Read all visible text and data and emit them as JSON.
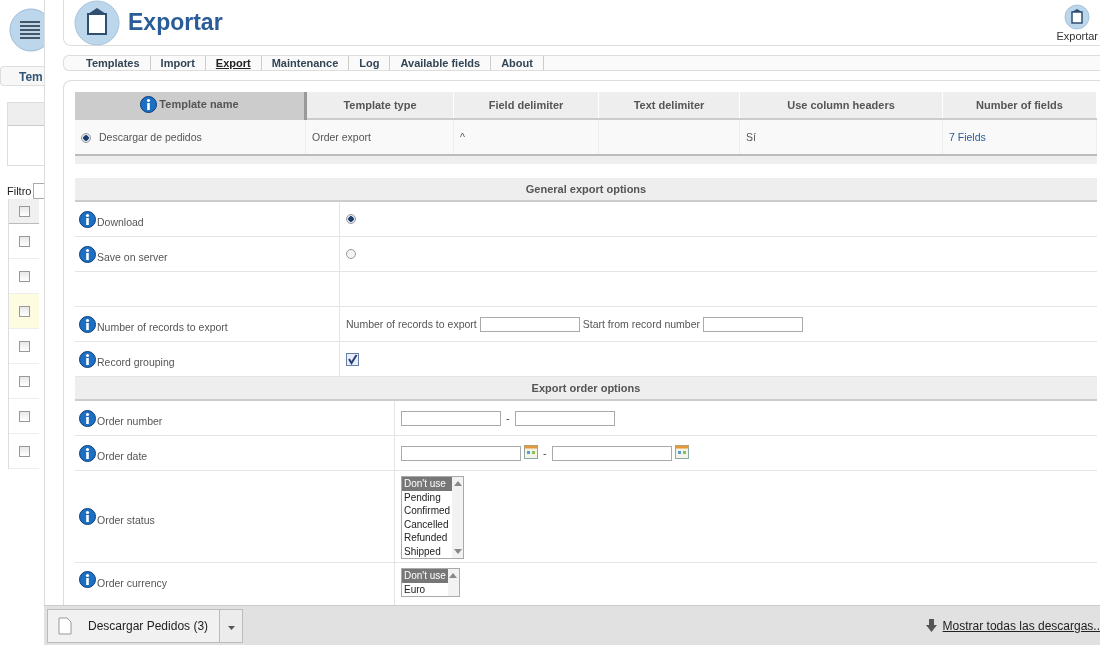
{
  "sidebar": {
    "tab_label": "Tem",
    "filter_label": "Filtro",
    "header_checked": false,
    "rows": [
      {
        "checked": false,
        "highlighted": false
      },
      {
        "checked": false,
        "highlighted": false
      },
      {
        "checked": false,
        "highlighted": true
      },
      {
        "checked": false,
        "highlighted": false
      },
      {
        "checked": false,
        "highlighted": false
      },
      {
        "checked": false,
        "highlighted": false
      },
      {
        "checked": false,
        "highlighted": false
      }
    ]
  },
  "header": {
    "title": "Exportar",
    "toolbar_button": "Exportar"
  },
  "tabs": [
    {
      "label": "Templates",
      "selected": false
    },
    {
      "label": "Import",
      "selected": false
    },
    {
      "label": "Export",
      "selected": true
    },
    {
      "label": "Maintenance",
      "selected": false
    },
    {
      "label": "Log",
      "selected": false
    },
    {
      "label": "Available fields",
      "selected": false
    },
    {
      "label": "About",
      "selected": false
    }
  ],
  "templates": {
    "columns": [
      {
        "label": "Template name",
        "sorted": true
      },
      {
        "label": "Template type",
        "sorted": false
      },
      {
        "label": "Field delimiter",
        "sorted": false
      },
      {
        "label": "Text delimiter",
        "sorted": false
      },
      {
        "label": "Use column headers",
        "sorted": false
      },
      {
        "label": "Number of fields",
        "sorted": false
      }
    ],
    "rows": [
      {
        "selected": true,
        "name": "Descargar de pedidos",
        "type": "Order export",
        "field_delimiter": "^",
        "use_column_headers": "Sí",
        "number_of_fields": "7 Fields"
      }
    ]
  },
  "sections": [
    {
      "title": "General export options",
      "rows": [
        {
          "kind": "radio",
          "label": "Download",
          "selected": true
        },
        {
          "kind": "radio",
          "label": "Save on server",
          "selected": false
        },
        {
          "kind": "blank"
        },
        {
          "kind": "record-range",
          "label": "Number of records to export",
          "fields": [
            {
              "label": "Number of records to export"
            },
            {
              "label": "Start from record number"
            }
          ]
        },
        {
          "kind": "checkbox",
          "label": "Record grouping",
          "checked": true
        }
      ]
    },
    {
      "title": "Export order options",
      "rows": [
        {
          "kind": "range",
          "label": "Order number",
          "separator": "-"
        },
        {
          "kind": "date-range",
          "label": "Order date",
          "separator": "-"
        },
        {
          "kind": "listbox",
          "label": "Order status",
          "options": [
            {
              "label": "Don't use",
              "selected": true
            },
            {
              "label": "Pending",
              "selected": false
            },
            {
              "label": "Confirmed",
              "selected": false
            },
            {
              "label": "Cancelled",
              "selected": false
            },
            {
              "label": "Refunded",
              "selected": false
            },
            {
              "label": "Shipped",
              "selected": false
            }
          ]
        },
        {
          "kind": "listbox",
          "label": "Order currency",
          "options": [
            {
              "label": "Don't use",
              "selected": true
            },
            {
              "label": "Euro",
              "selected": false
            }
          ]
        }
      ]
    }
  ],
  "download_bar": {
    "item": "Descargar Pedidos (3)",
    "show_all": "Mostrar todas las descargas.."
  }
}
